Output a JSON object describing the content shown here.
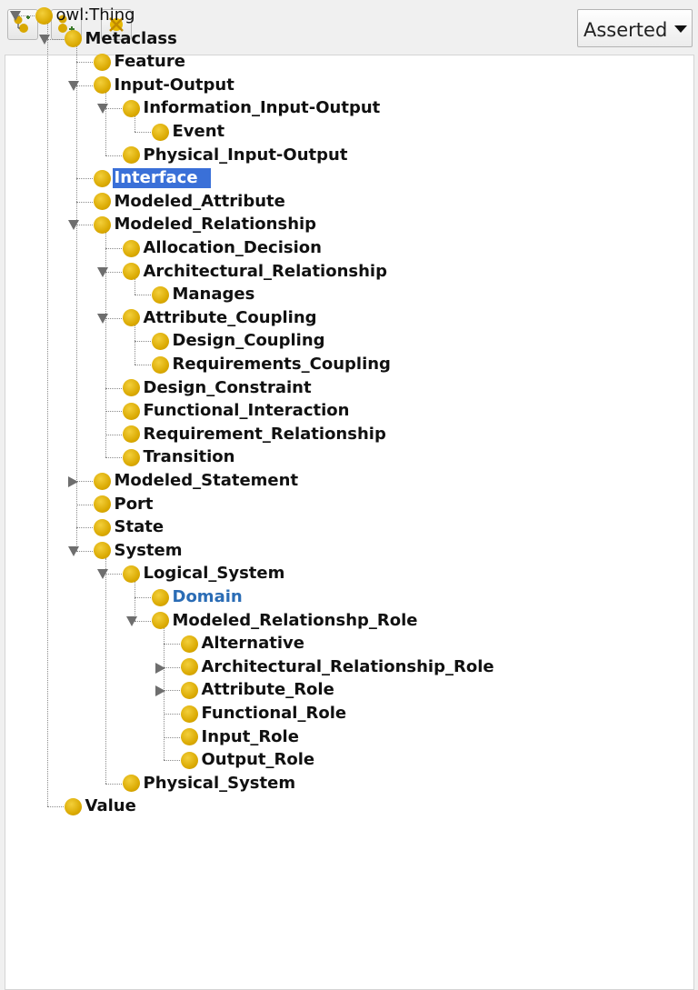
{
  "toolbar": {
    "add_subclass_icon": "add-subclass-icon",
    "add_sibling_icon": "add-sibling-icon",
    "delete_icon": "delete-class-icon",
    "view_mode": "Asserted"
  },
  "tree": {
    "nodes": [
      {
        "label": "owl:Thing",
        "depth": 0,
        "toggle": "open",
        "style": "normal"
      },
      {
        "label": "Metaclass",
        "depth": 1,
        "toggle": "open"
      },
      {
        "label": "Feature",
        "depth": 2
      },
      {
        "label": "Input-Output",
        "depth": 2,
        "toggle": "open"
      },
      {
        "label": "Information_Input-Output",
        "depth": 3,
        "toggle": "open"
      },
      {
        "label": "Event",
        "depth": 4
      },
      {
        "label": "Physical_Input-Output",
        "depth": 3
      },
      {
        "label": "Interface",
        "depth": 2,
        "style": "selected"
      },
      {
        "label": "Modeled_Attribute",
        "depth": 2
      },
      {
        "label": "Modeled_Relationship",
        "depth": 2,
        "toggle": "open"
      },
      {
        "label": "Allocation_Decision",
        "depth": 3
      },
      {
        "label": "Architectural_Relationship",
        "depth": 3,
        "toggle": "open"
      },
      {
        "label": "Manages",
        "depth": 4
      },
      {
        "label": "Attribute_Coupling",
        "depth": 3,
        "toggle": "open"
      },
      {
        "label": "Design_Coupling",
        "depth": 4
      },
      {
        "label": "Requirements_Coupling",
        "depth": 4
      },
      {
        "label": "Design_Constraint",
        "depth": 3
      },
      {
        "label": "Functional_Interaction",
        "depth": 3
      },
      {
        "label": "Requirement_Relationship",
        "depth": 3
      },
      {
        "label": "Transition",
        "depth": 3
      },
      {
        "label": "Modeled_Statement",
        "depth": 2,
        "toggle": "closed"
      },
      {
        "label": "Port",
        "depth": 2
      },
      {
        "label": "State",
        "depth": 2
      },
      {
        "label": "System",
        "depth": 2,
        "toggle": "open"
      },
      {
        "label": "Logical_System",
        "depth": 3,
        "toggle": "open"
      },
      {
        "label": "Domain",
        "depth": 4,
        "style": "blue"
      },
      {
        "label": "Modeled_Relationshp_Role",
        "depth": 4,
        "toggle": "open"
      },
      {
        "label": "Alternative",
        "depth": 5
      },
      {
        "label": "Architectural_Relationship_Role",
        "depth": 5,
        "toggle": "closed"
      },
      {
        "label": "Attribute_Role",
        "depth": 5,
        "toggle": "closed"
      },
      {
        "label": "Functional_Role",
        "depth": 5
      },
      {
        "label": "Input_Role",
        "depth": 5
      },
      {
        "label": "Output_Role",
        "depth": 5
      },
      {
        "label": "Physical_System",
        "depth": 3
      },
      {
        "label": "Value",
        "depth": 1
      }
    ]
  }
}
